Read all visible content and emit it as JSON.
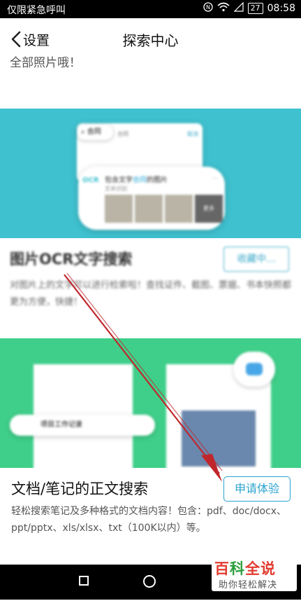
{
  "status_bar": {
    "left_text": "仅限紧急呼叫",
    "time": "08:58",
    "battery": "27",
    "icons": [
      "nfc-icon",
      "wifi-icon",
      "signal-icon",
      "battery-icon"
    ]
  },
  "nav": {
    "back_label": "设置",
    "title": "探索中心"
  },
  "top_section": {
    "text_tail": "全部照片哦！"
  },
  "ocr_banner": {
    "search_chip": "合同",
    "search_value": "合同",
    "cancel": "取消",
    "badge": "OCR",
    "result_title_pre": "包含文字",
    "result_title_hl": "合同",
    "result_title_post": "的图片",
    "result_subtitle": "文本识别",
    "more": "更多"
  },
  "section_ocr": {
    "title": "图片OCR文字搜索",
    "button": "收藏中...",
    "description": "对图片上的文字可以进行检索啦！查找证件、截图、票据、书本快照都更为方便，快捷！"
  },
  "doc_banner": {
    "folder_label": "项目工作记录"
  },
  "section_doc": {
    "title": "文档/笔记的正文搜索",
    "button": "申请体验",
    "description": "轻松搜索笔记及多种格式的文档内容！包含：pdf、doc/docx、ppt/pptx、xls/xlsx、txt（100K以内）等。"
  },
  "watermark": {
    "line1_a": "百",
    "line1_b": "科",
    "line1_c": "全说",
    "line2": "助你轻松解决"
  },
  "colors": {
    "ocr_banner": "#3fc1cf",
    "doc_banner": "#3fcf8a",
    "accent": "#2ba3cf",
    "arrow": "#c0272d"
  }
}
